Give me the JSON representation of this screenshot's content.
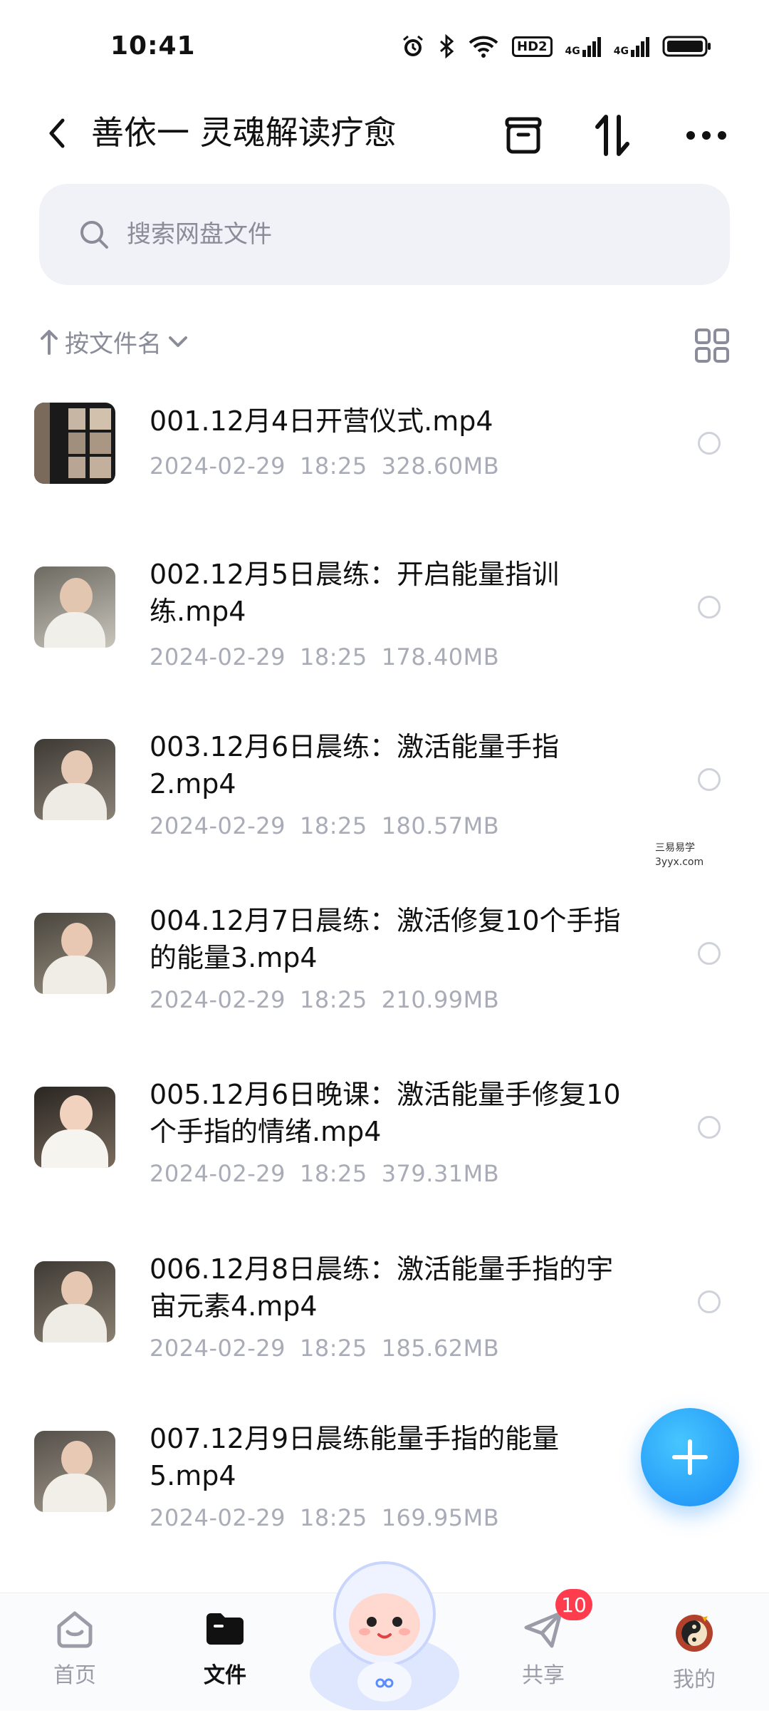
{
  "status_bar": {
    "time": "10:41",
    "hd_label": "HD2",
    "net1": "4G",
    "net2": "4G"
  },
  "header": {
    "title": "善依一 灵魂解读疗愈"
  },
  "search": {
    "placeholder": "搜索网盘文件"
  },
  "sort": {
    "label": "按文件名"
  },
  "files": [
    {
      "name": "001.12月4日开营仪式.mp4",
      "date": "2024-02-29",
      "time": "18:25",
      "size": "328.60MB"
    },
    {
      "name": "002.12月5日晨练：开启能量指训练.mp4",
      "date": "2024-02-29",
      "time": "18:25",
      "size": "178.40MB"
    },
    {
      "name": "003.12月6日晨练：激活能量手指2.mp4",
      "date": "2024-02-29",
      "time": "18:25",
      "size": "180.57MB"
    },
    {
      "name": "004.12月7日晨练：激活修复10个手指的能量3.mp4",
      "date": "2024-02-29",
      "time": "18:25",
      "size": "210.99MB"
    },
    {
      "name": "005.12月6日晚课：激活能量手修复10个手指的情绪.mp4",
      "date": "2024-02-29",
      "time": "18:25",
      "size": "379.31MB"
    },
    {
      "name": "006.12月8日晨练：激活能量手指的宇宙元素4.mp4",
      "date": "2024-02-29",
      "time": "18:25",
      "size": "185.62MB"
    },
    {
      "name": "007.12月9日晨练能量手指的能量5.mp4",
      "date": "2024-02-29",
      "time": "18:25",
      "size": "169.95MB"
    }
  ],
  "watermark": {
    "line1": "三易易学",
    "line2": "3yyx.com"
  },
  "tabbar": {
    "home": "首页",
    "files": "文件",
    "share": "共享",
    "share_badge": "10",
    "mine": "我的"
  },
  "colors": {
    "accent": "#1a8cf5",
    "badge": "#ff3b4e",
    "muted": "#a9acb7"
  }
}
